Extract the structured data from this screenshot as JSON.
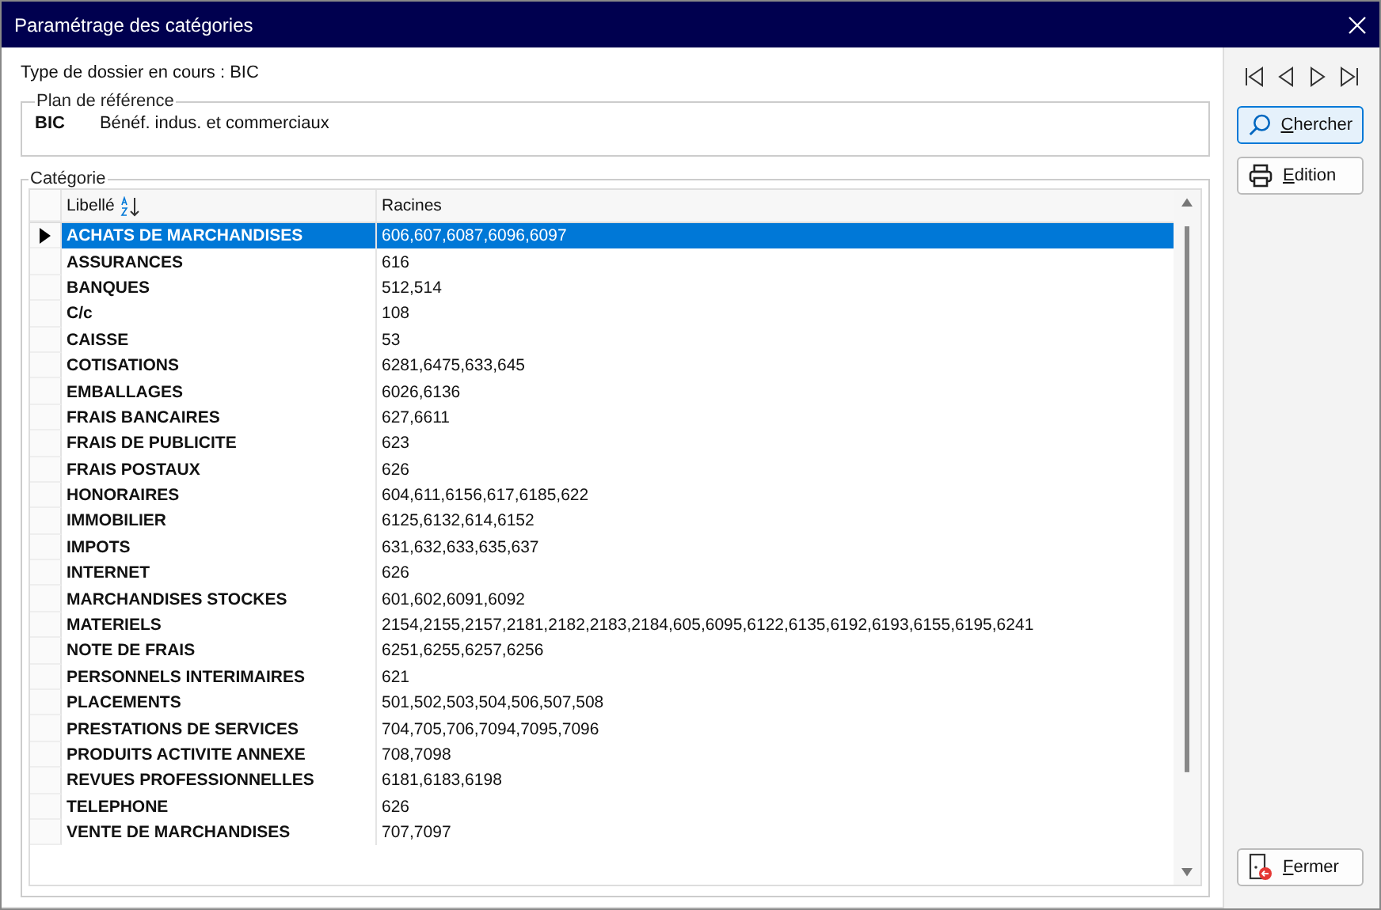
{
  "window": {
    "title": "Paramétrage des catégories"
  },
  "dossier_type": "Type de dossier en cours : BIC",
  "plan": {
    "legend": "Plan de référence",
    "code": "BIC",
    "label": "Bénéf. indus. et commerciaux"
  },
  "categorie": {
    "legend": "Catégorie",
    "columns": [
      {
        "label": "Libellé",
        "sorted": true
      },
      {
        "label": "Racines",
        "sorted": false
      }
    ],
    "rows": [
      {
        "libelle": "ACHATS DE MARCHANDISES",
        "racines": "606,607,6087,6096,6097",
        "selected": true
      },
      {
        "libelle": "ASSURANCES",
        "racines": "616",
        "selected": false
      },
      {
        "libelle": "BANQUES",
        "racines": "512,514",
        "selected": false
      },
      {
        "libelle": "C/c",
        "racines": "108",
        "selected": false
      },
      {
        "libelle": "CAISSE",
        "racines": "53",
        "selected": false
      },
      {
        "libelle": "COTISATIONS",
        "racines": "6281,6475,633,645",
        "selected": false
      },
      {
        "libelle": "EMBALLAGES",
        "racines": "6026,6136",
        "selected": false
      },
      {
        "libelle": "FRAIS BANCAIRES",
        "racines": "627,6611",
        "selected": false
      },
      {
        "libelle": "FRAIS DE PUBLICITE",
        "racines": "623",
        "selected": false
      },
      {
        "libelle": "FRAIS POSTAUX",
        "racines": "626",
        "selected": false
      },
      {
        "libelle": "HONORAIRES",
        "racines": "604,611,6156,617,6185,622",
        "selected": false
      },
      {
        "libelle": "IMMOBILIER",
        "racines": "6125,6132,614,6152",
        "selected": false
      },
      {
        "libelle": "IMPOTS",
        "racines": "631,632,633,635,637",
        "selected": false
      },
      {
        "libelle": "INTERNET",
        "racines": "626",
        "selected": false
      },
      {
        "libelle": "MARCHANDISES STOCKES",
        "racines": "601,602,6091,6092",
        "selected": false
      },
      {
        "libelle": "MATERIELS",
        "racines": "2154,2155,2157,2181,2182,2183,2184,605,6095,6122,6135,6192,6193,6155,6195,6241",
        "selected": false
      },
      {
        "libelle": "NOTE DE FRAIS",
        "racines": "6251,6255,6257,6256",
        "selected": false
      },
      {
        "libelle": "PERSONNELS INTERIMAIRES",
        "racines": "621",
        "selected": false
      },
      {
        "libelle": "PLACEMENTS",
        "racines": "501,502,503,504,506,507,508",
        "selected": false
      },
      {
        "libelle": "PRESTATIONS DE SERVICES",
        "racines": "704,705,706,7094,7095,7096",
        "selected": false
      },
      {
        "libelle": "PRODUITS ACTIVITE ANNEXE",
        "racines": "708,7098",
        "selected": false
      },
      {
        "libelle": "REVUES PROFESSIONNELLES",
        "racines": "6181,6183,6198",
        "selected": false
      },
      {
        "libelle": "TELEPHONE",
        "racines": "626",
        "selected": false
      },
      {
        "libelle": "VENTE DE MARCHANDISES",
        "racines": "707,7097",
        "selected": false
      }
    ]
  },
  "buttons": [
    {
      "kind": "search",
      "label": "Chercher",
      "focused": true
    },
    {
      "kind": "print",
      "label": "Edition",
      "focused": false
    }
  ],
  "close_button": {
    "label": "Fermer"
  }
}
